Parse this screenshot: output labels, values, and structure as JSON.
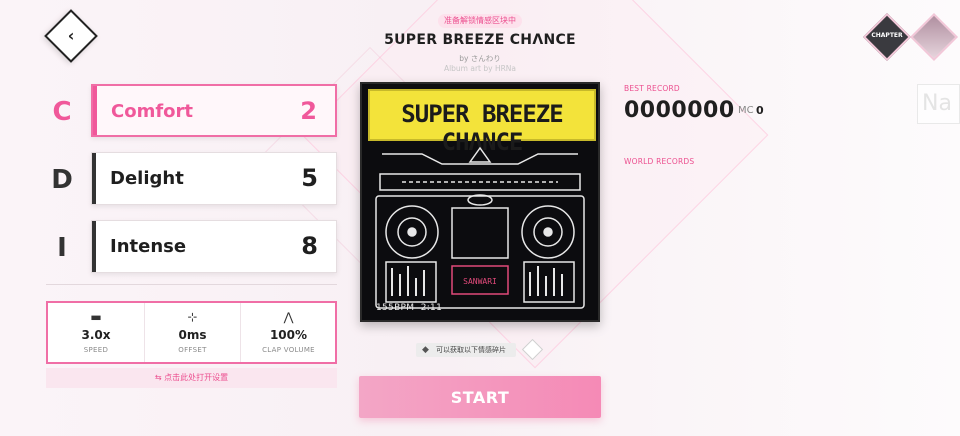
{
  "header": {
    "status_badge": "准备解锁情感区块中",
    "song_title": "5UPER BREEZE CHΛNCE",
    "artist": "by さんわり",
    "album_art_credit": "Album art by HRNa"
  },
  "chapter": {
    "label": "CHAPTER"
  },
  "difficulties": [
    {
      "icon": "C",
      "name": "Comfort",
      "level": "2",
      "selected": true
    },
    {
      "icon": "D",
      "name": "Delight",
      "level": "5",
      "selected": false
    },
    {
      "icon": "I",
      "name": "Intense",
      "level": "8",
      "selected": false
    }
  ],
  "settings": {
    "items": [
      {
        "icon": "speed-icon",
        "glyph": "▬",
        "value": "3.0x",
        "label": "SPEED"
      },
      {
        "icon": "offset-icon",
        "glyph": "⊹",
        "value": "0ms",
        "label": "OFFSET"
      },
      {
        "icon": "clap-volume-icon",
        "glyph": "⋀",
        "value": "100%",
        "label": "CLAP VOLUME"
      }
    ],
    "open_label": "点击此处打开设置",
    "open_icon": "⇆"
  },
  "album": {
    "title_text": "SUPER BREEZE CHΛNCE",
    "inner_tag": "SANWARI",
    "bpm": "155BPM",
    "duration": "2:11"
  },
  "shards": {
    "label": "可以获取以下情感碎片",
    "icon": "◆"
  },
  "start_label": "START",
  "records": {
    "best_label": "BEST RECORD",
    "best_score": "0000000",
    "mc_label": "MC",
    "mc_value": "0",
    "world_label": "WORLD RECORDS",
    "na_stamp": "Na"
  },
  "colors": {
    "accent": "#f0589a",
    "start_gradient": [
      "#f3a6c6",
      "#f58ab6"
    ]
  }
}
